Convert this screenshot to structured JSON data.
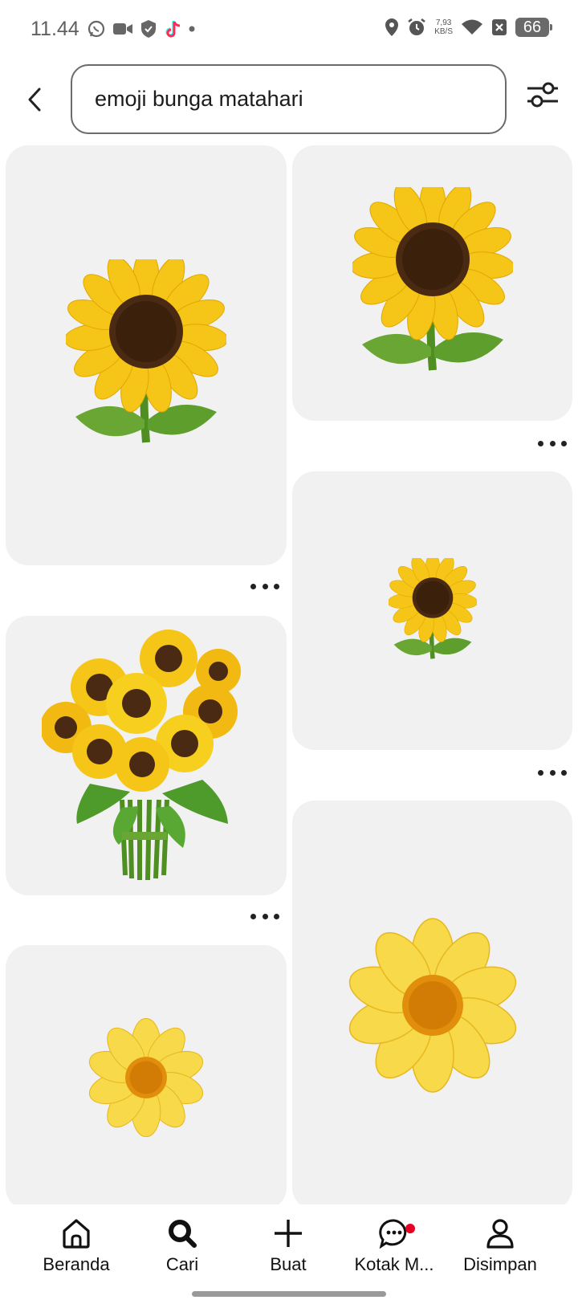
{
  "status_bar": {
    "time": "11.44",
    "net_speed_value": "7,93",
    "net_speed_unit": "KB/S",
    "battery": "66",
    "icons": [
      "whatsapp-icon",
      "video-call-icon",
      "shield-icon",
      "tiktok-icon",
      "dot-icon",
      "location-icon",
      "alarm-icon",
      "wifi-icon",
      "no-sim-icon",
      "battery-icon"
    ]
  },
  "search": {
    "query": "emoji bunga matahari"
  },
  "header_icons": {
    "back": "chevron-left-icon",
    "filter": "sliders-icon"
  },
  "pins": [
    {
      "name": "pin-sunflower-1",
      "image": "sunflower-emoji",
      "has_menu": true
    },
    {
      "name": "pin-sunflower-2",
      "image": "sunflower-emoji",
      "has_menu": true
    },
    {
      "name": "pin-sunflower-3",
      "image": "sunflower-emoji-small",
      "has_menu": true
    },
    {
      "name": "pin-sunflower-bouquet",
      "image": "sunflower-bouquet",
      "has_menu": true
    },
    {
      "name": "pin-yellow-daisy-1",
      "image": "yellow-daisy",
      "has_menu": false
    },
    {
      "name": "pin-yellow-daisy-2",
      "image": "yellow-daisy",
      "has_menu": false
    }
  ],
  "nav": {
    "items": [
      {
        "label": "Beranda",
        "icon": "home-icon"
      },
      {
        "label": "Cari",
        "icon": "search-icon",
        "active": true
      },
      {
        "label": "Buat",
        "icon": "plus-icon"
      },
      {
        "label": "Kotak M...",
        "icon": "chat-icon",
        "notification": true
      },
      {
        "label": "Disimpan",
        "icon": "profile-icon"
      }
    ]
  },
  "colors": {
    "petal": "#f5c518",
    "petal_dark": "#e0a800",
    "center": "#4a2a12",
    "leaf": "#5e9e2c",
    "daisy_petal": "#f7d94a",
    "daisy_center": "#e08e0b",
    "notification": "#e60023"
  }
}
